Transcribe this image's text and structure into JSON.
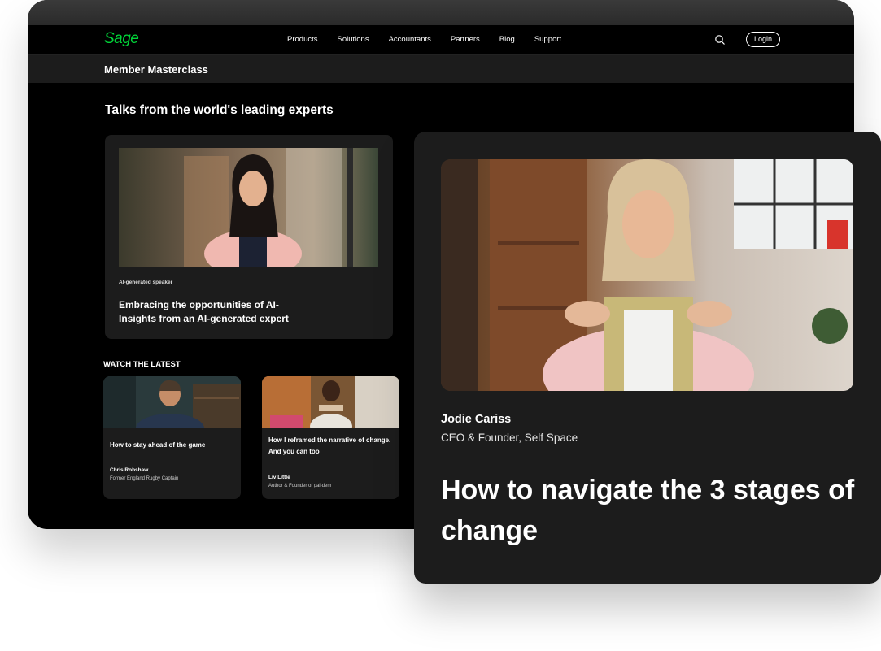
{
  "brand": {
    "logo_text": "Sage",
    "accent": "#00d639"
  },
  "nav": {
    "items": [
      "Products",
      "Solutions",
      "Accountants",
      "Partners",
      "Blog",
      "Support"
    ],
    "search_icon": "search-icon",
    "login_label": "Login"
  },
  "subbar": {
    "title": "Member Masterclass"
  },
  "main": {
    "section_title": "Talks from the world's leading experts",
    "feature": {
      "tag": "AI-generated speaker",
      "title": "Embracing the opportunities of AI-Insights from an AI-generated expert"
    },
    "watch_label": "WATCH THE LATEST",
    "cards": [
      {
        "title": "How to stay ahead of the game",
        "name": "Chris Robshaw",
        "role": "Former England Rugby Captain"
      },
      {
        "title": "How I reframed the narrative of change. And you can too",
        "name": "Liv Little",
        "role": "Author & Founder of gal-dem"
      }
    ]
  },
  "overlay": {
    "speaker_name": "Jodie Cariss",
    "speaker_role": "CEO & Founder, Self Space",
    "title": "How to navigate the 3 stages of change"
  }
}
